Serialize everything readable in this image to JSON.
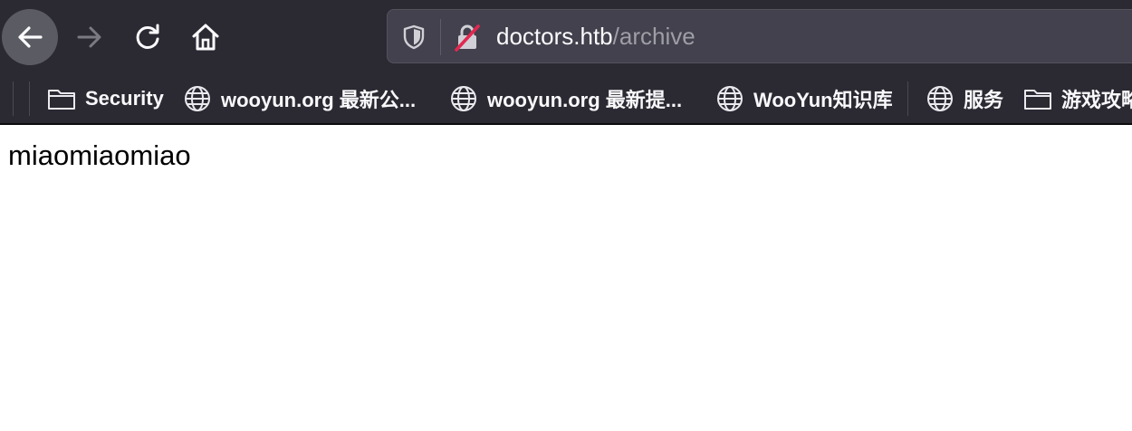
{
  "toolbar": {
    "back_icon": "arrow-left-icon",
    "forward_icon": "arrow-right-icon",
    "reload_icon": "reload-icon",
    "home_icon": "home-icon"
  },
  "urlbar": {
    "host": "doctors.htb",
    "path": "/archive",
    "tracking_icon": "shield-icon",
    "security_icon": "insecure-lock-icon"
  },
  "bookmarks": [
    {
      "label": "Security",
      "icon": "folder-icon"
    },
    {
      "label": "wooyun.org 最新公...",
      "icon": "globe-icon"
    },
    {
      "label": "wooyun.org 最新提...",
      "icon": "globe-icon"
    },
    {
      "label": "WooYun知识库",
      "icon": "globe-icon"
    },
    {
      "label": "服务",
      "icon": "globe-icon"
    },
    {
      "label": "游戏攻略",
      "icon": "folder-icon"
    }
  ],
  "colors": {
    "chrome_bg": "#2b2a33",
    "urlbar_bg": "#42414d",
    "insecure_slash": "#e22850"
  },
  "page": {
    "text": "miaomiaomiao"
  }
}
